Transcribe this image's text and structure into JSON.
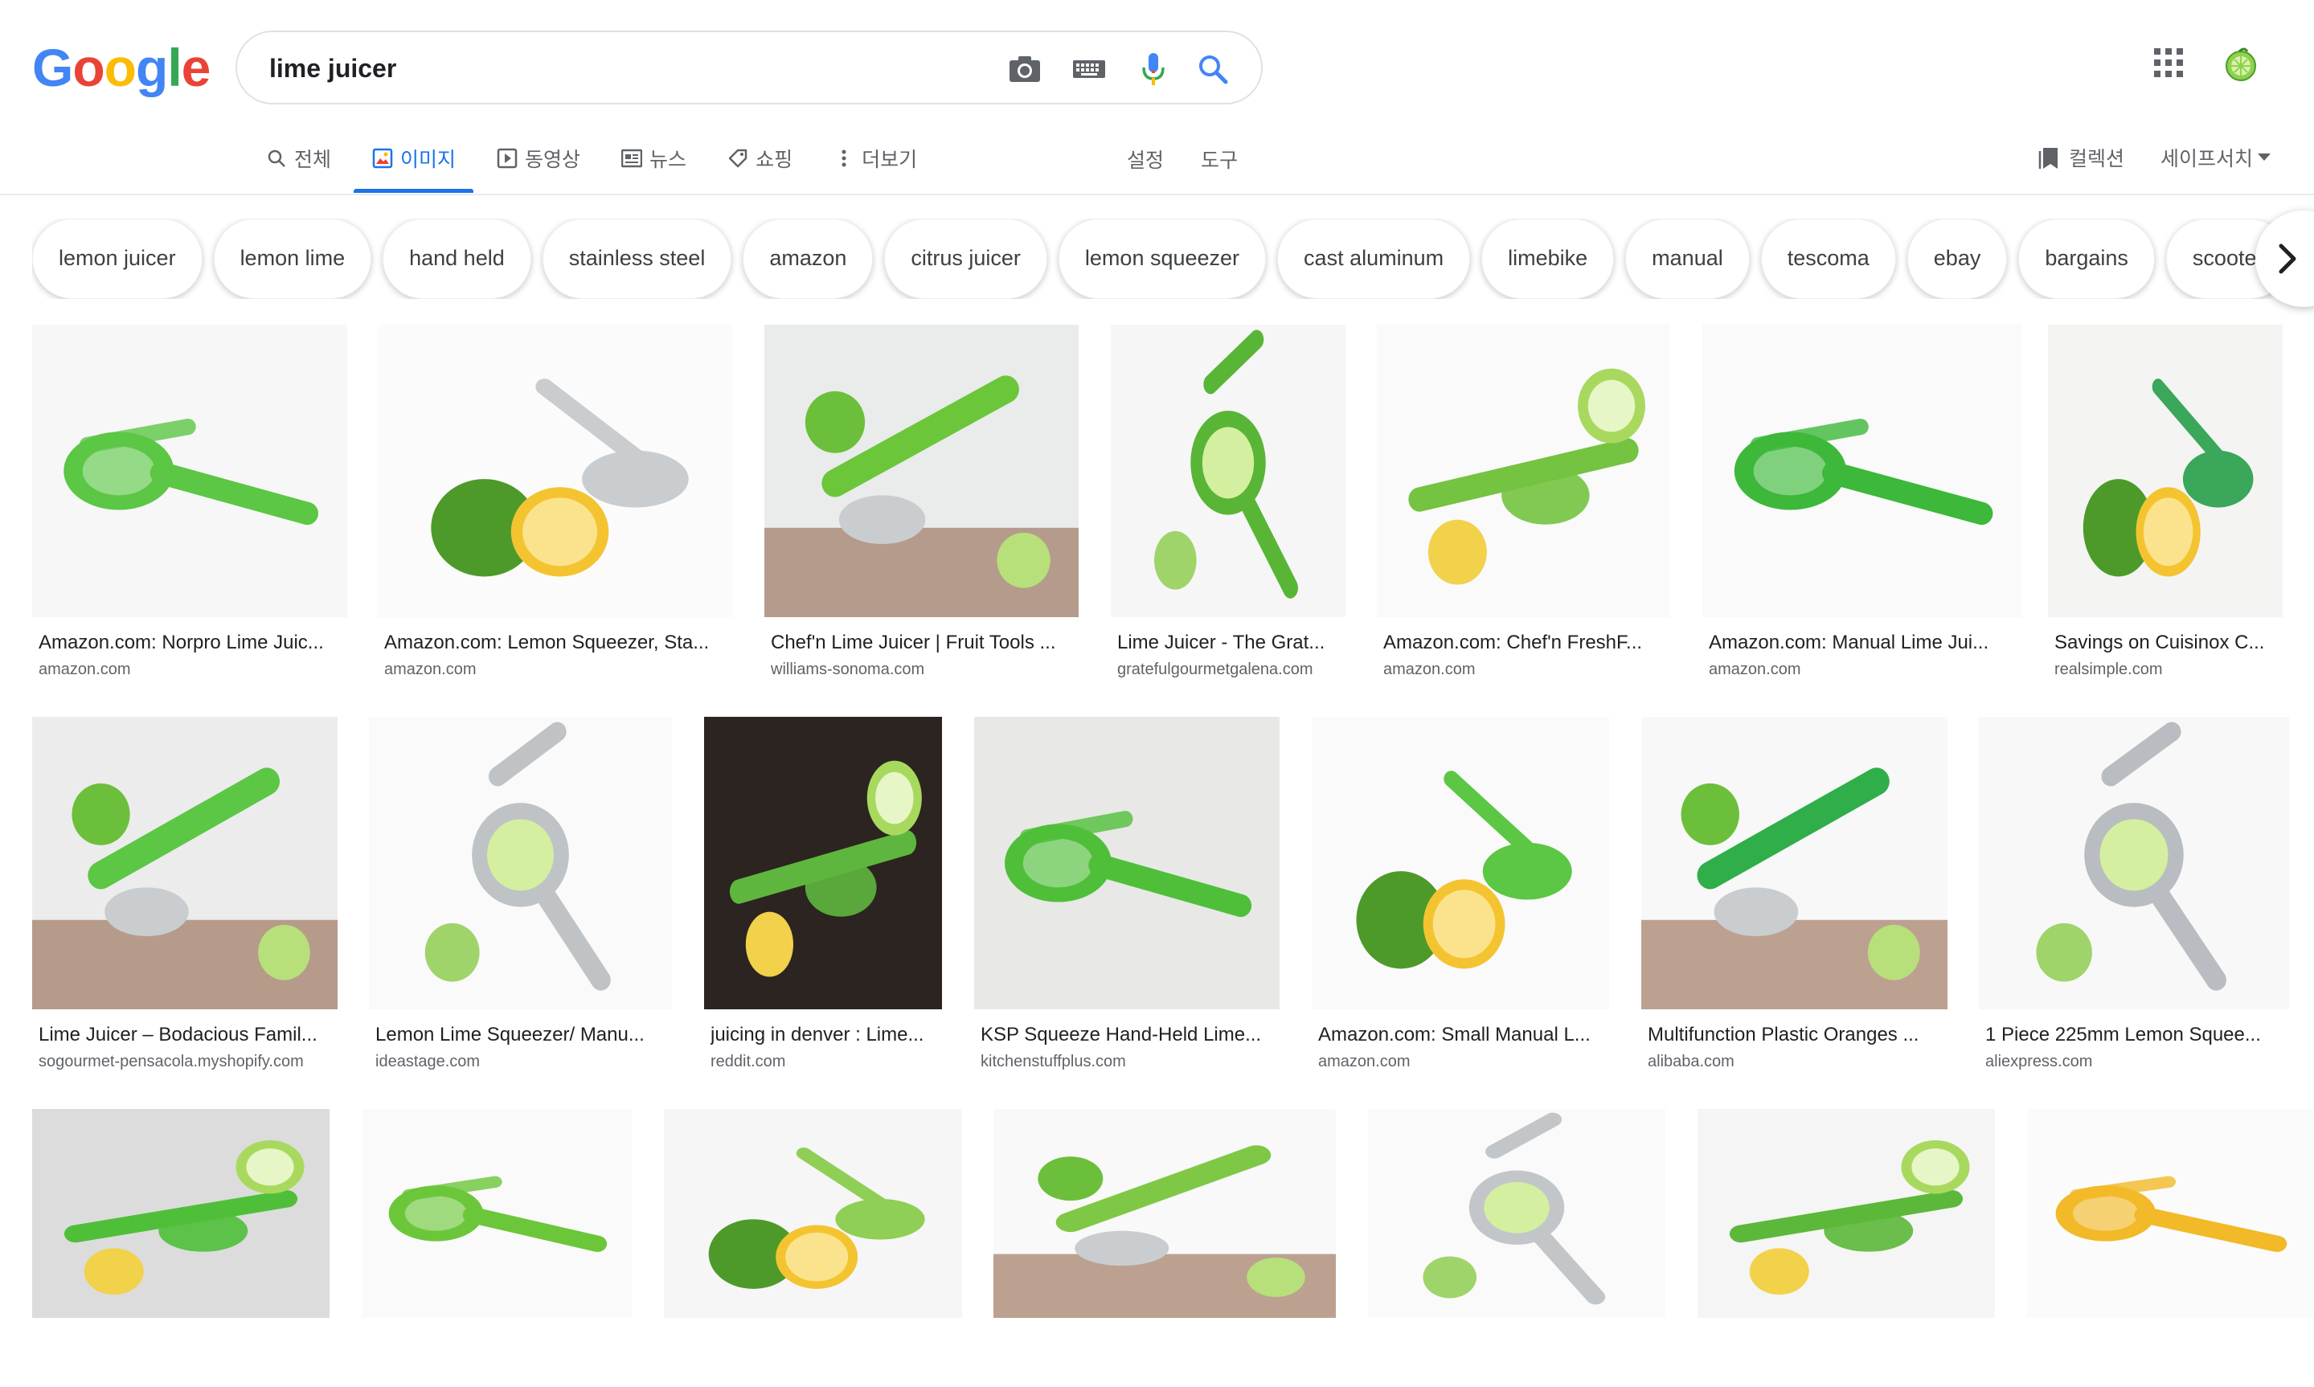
{
  "logo": [
    "G",
    "o",
    "o",
    "g",
    "l",
    "e"
  ],
  "search": {
    "query": "lime juicer"
  },
  "tabs": [
    {
      "label": "전체",
      "icon": "search-icon",
      "active": false
    },
    {
      "label": "이미지",
      "icon": "image-icon",
      "active": true
    },
    {
      "label": "동영상",
      "icon": "video-icon",
      "active": false
    },
    {
      "label": "뉴스",
      "icon": "news-icon",
      "active": false
    },
    {
      "label": "쇼핑",
      "icon": "tag-icon",
      "active": false
    },
    {
      "label": "더보기",
      "icon": "more-vert-icon",
      "active": false
    }
  ],
  "tools": {
    "settings": "설정",
    "tools": "도구"
  },
  "right_links": {
    "collections": "컬렉션",
    "safesearch": "세이프서치"
  },
  "chips": [
    "lemon juicer",
    "lemon lime",
    "hand held",
    "stainless steel",
    "amazon",
    "citrus juicer",
    "lemon squeezer",
    "cast aluminum",
    "limebike",
    "manual",
    "tescoma",
    "ebay",
    "bargains",
    "scooter"
  ],
  "results": [
    {
      "title": "Amazon.com: Norpro Lime Juic...",
      "source": "amazon.com",
      "bg": "#f7f7f7",
      "accent": "#5cc645"
    },
    {
      "title": "Amazon.com: Lemon Squeezer, Sta...",
      "source": "amazon.com",
      "bg": "#fbfbfb",
      "accent": "#c9cdd0"
    },
    {
      "title": "Chef'n Lime Juicer | Fruit Tools ...",
      "source": "williams-sonoma.com",
      "bg": "#e9ecea",
      "accent": "#6cc63a"
    },
    {
      "title": "Lime Juicer - The Grat...",
      "source": "gratefulgourmetgalena.com",
      "bg": "#f6f6f6",
      "accent": "#59b536"
    },
    {
      "title": "Amazon.com: Chef'n FreshF...",
      "source": "amazon.com",
      "bg": "#fafafa",
      "accent": "#74c341"
    },
    {
      "title": "Amazon.com: Manual Lime Jui...",
      "source": "amazon.com",
      "bg": "#fafafa",
      "accent": "#3db83a"
    },
    {
      "title": "Savings on Cuisinox C...",
      "source": "realsimple.com",
      "bg": "#f4f5f3",
      "accent": "#3aa75a"
    },
    {
      "title": "Lime Juicer – Bodacious Famil...",
      "source": "sogourmet-pensacola.myshopify.com",
      "bg": "#ececec",
      "accent": "#5cc645"
    },
    {
      "title": "Lemon Lime Squeezer/ Manu...",
      "source": "ideastage.com",
      "bg": "#fafafa",
      "accent": "#bfc3c6"
    },
    {
      "title": "juicing in denver : Lime...",
      "source": "reddit.com",
      "bg": "#2b2420",
      "accent": "#5fb63e"
    },
    {
      "title": "KSP Squeeze Hand-Held Lime...",
      "source": "kitchenstuffplus.com",
      "bg": "#e8e8e6",
      "accent": "#4fbf3a"
    },
    {
      "title": "Amazon.com: Small Manual L...",
      "source": "amazon.com",
      "bg": "#fafafa",
      "accent": "#5cc645"
    },
    {
      "title": "Multifunction Plastic Oranges ...",
      "source": "alibaba.com",
      "bg": "#f8f8f8",
      "accent": "#2fae4a"
    },
    {
      "title": "1 Piece 225mm Lemon Squee...",
      "source": "aliexpress.com",
      "bg": "#f8f8f8",
      "accent": "#b9bdc1"
    },
    {
      "title": "",
      "source": "",
      "bg": "#dcdcdc",
      "accent": "#4fbf3a"
    },
    {
      "title": "",
      "source": "",
      "bg": "#fafafa",
      "accent": "#6cc63a"
    },
    {
      "title": "",
      "source": "",
      "bg": "#f6f6f6",
      "accent": "#8fcf55"
    },
    {
      "title": "",
      "source": "",
      "bg": "#f9f9f9",
      "accent": "#7fc846"
    },
    {
      "title": "",
      "source": "",
      "bg": "#fafafa",
      "accent": "#c3c6c9"
    },
    {
      "title": "",
      "source": "",
      "bg": "#f5f5f5",
      "accent": "#5cb83a"
    },
    {
      "title": "",
      "source": "",
      "bg": "#fbfbfb",
      "accent": "#f2b928"
    }
  ],
  "colors": {
    "brand_blue": "#1a73e8",
    "text_grey": "#5f6368"
  }
}
